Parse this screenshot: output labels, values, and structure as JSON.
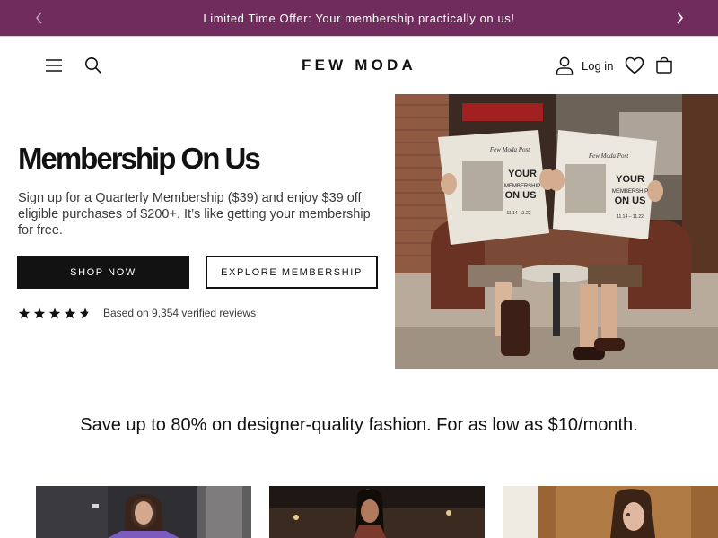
{
  "announcement": {
    "text": "Limited Time Offer: Your membership practically on us!",
    "prev_icon": "chevron-left-icon",
    "next_icon": "chevron-right-icon",
    "background": "#6f2c5d"
  },
  "header": {
    "logo": "FEW MODA",
    "login_label": "Log in",
    "icons": [
      "menu-icon",
      "search-icon",
      "account-icon",
      "heart-icon",
      "cart-icon"
    ]
  },
  "hero": {
    "title": "Membership On Us",
    "description": "Sign up for a Quarterly Membership ($39) and enjoy $39 off eligible purchases of $200+. It’s like getting your membership for free.",
    "shop_button": "SHOP NOW",
    "explore_button": "EXPLORE MEMBERSHIP",
    "rating": 4.5,
    "reviews_text": "Based on 9,354 verified reviews",
    "image": {
      "newspaper_masthead": "Few Moda Post",
      "newspaper_headline_1": "YOUR",
      "newspaper_headline_2": "MEMBERSHIP",
      "newspaper_headline_3": "ON US",
      "newspaper_dates_left": "11.14–11.22",
      "newspaper_dates_right": "11.14 – 11.22"
    }
  },
  "promo": {
    "headline": "Save up to 80% on designer-quality fashion. For as low as $10/month."
  }
}
